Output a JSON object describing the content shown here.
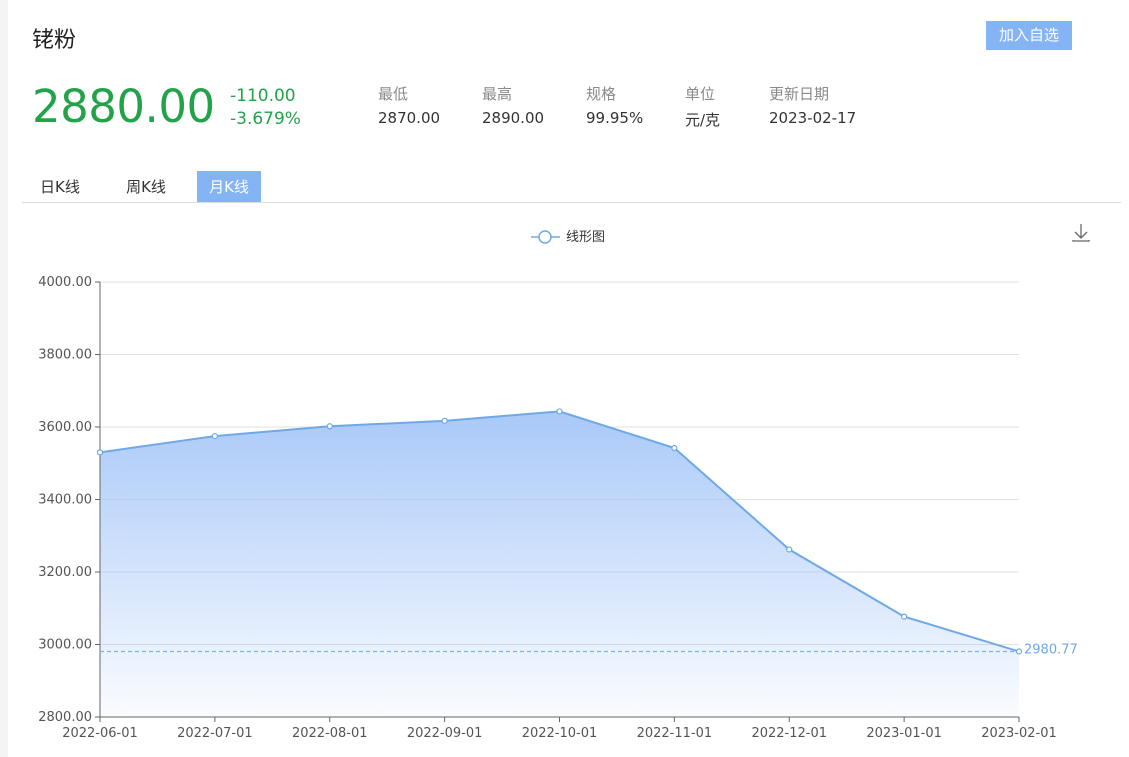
{
  "header": {
    "title": "铑粉",
    "favorite_button": "加入自选"
  },
  "quote": {
    "price": "2880.00",
    "change": "-110.00",
    "change_percent": "-3.679%",
    "stats": [
      {
        "label": "最低",
        "value": "2870.00"
      },
      {
        "label": "最高",
        "value": "2890.00"
      },
      {
        "label": "规格",
        "value": "99.95%"
      },
      {
        "label": "单位",
        "value": "元/克"
      },
      {
        "label": "更新日期",
        "value": "2023-02-17"
      }
    ]
  },
  "tabs": [
    {
      "label": "日K线",
      "active": false
    },
    {
      "label": "周K线",
      "active": false
    },
    {
      "label": "月K线",
      "active": true
    }
  ],
  "toolbox": {
    "download_icon": "download-icon"
  },
  "colors": {
    "price_down": "#22a34a",
    "accent": "#84b4f4",
    "line": "#6fa8e8"
  },
  "chart_data": {
    "type": "area",
    "legend": [
      "线形图"
    ],
    "legend_position": "top-center",
    "x": [
      "2022-06-01",
      "2022-07-01",
      "2022-08-01",
      "2022-09-01",
      "2022-10-01",
      "2022-11-01",
      "2022-12-01",
      "2023-01-01",
      "2023-02-01"
    ],
    "series": [
      {
        "name": "线形图",
        "values": [
          3530,
          3575,
          3602,
          3617,
          3643,
          3542,
          3262,
          3077,
          2980.77
        ]
      }
    ],
    "ylim": [
      2800,
      4000
    ],
    "yticks": [
      "2800.00",
      "3000.00",
      "3200.00",
      "3400.00",
      "3600.00",
      "3800.00",
      "4000.00"
    ],
    "mark_line": {
      "value": 2980.77,
      "label": "2980.77"
    },
    "grid": true
  }
}
